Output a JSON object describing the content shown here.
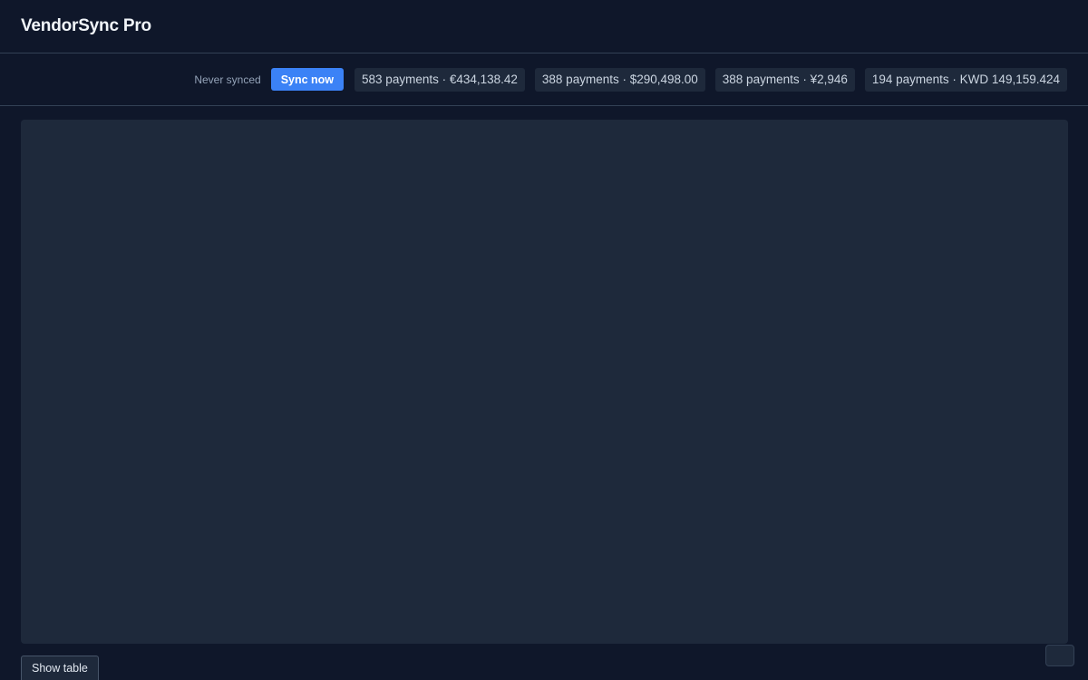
{
  "app": {
    "title": "VendorSync Pro"
  },
  "toolbar": {
    "sync_status": "Never synced",
    "sync_button_label": "Sync now",
    "summaries": [
      {
        "label": "583 payments · €434,138.42"
      },
      {
        "label": "388 payments · $290,498.00"
      },
      {
        "label": "388 payments · ¥2,946"
      },
      {
        "label": "194 payments · KWD 149,159.424"
      }
    ]
  },
  "footer": {
    "show_table_label": "Show table"
  },
  "colors": {
    "background": "#0f172a",
    "panel": "#1e293b",
    "accent": "#3b82f6",
    "border": "#334155"
  }
}
